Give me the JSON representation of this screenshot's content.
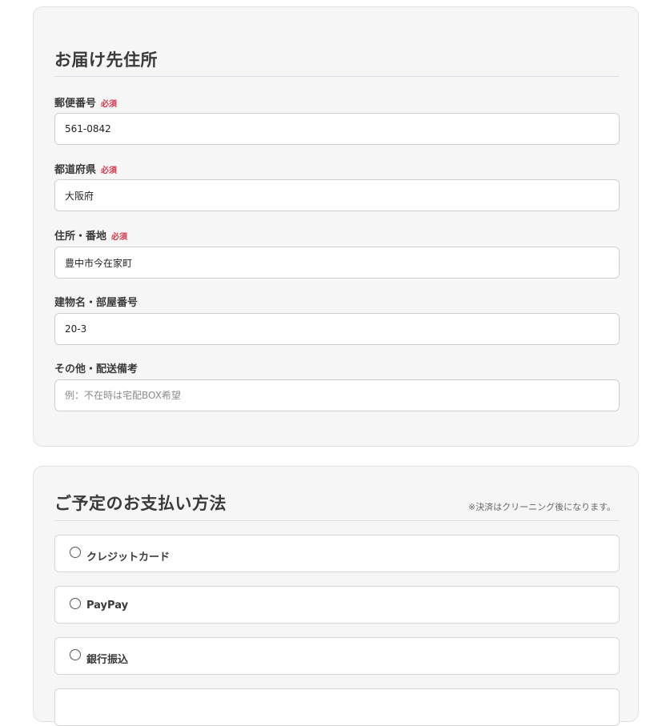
{
  "address_section": {
    "title": "お届け先住所",
    "fields": [
      {
        "label": "郵便番号",
        "required": true,
        "value": "561-0842",
        "placeholder": ""
      },
      {
        "label": "都道府県",
        "required": true,
        "value": "大阪府",
        "placeholder": ""
      },
      {
        "label": "住所・番地",
        "required": true,
        "value": "豊中市今在家町",
        "placeholder": ""
      },
      {
        "label": "建物名・部屋番号",
        "required": false,
        "value": "20-3",
        "placeholder": ""
      },
      {
        "label": "その他・配送備考",
        "required": false,
        "value": "",
        "placeholder": "例：不在時は宅配BOX希望"
      }
    ],
    "required_label": "必須"
  },
  "payment_section": {
    "title": "ご予定のお支払い方法",
    "note": "※決済はクリーニング後になります。",
    "options": [
      {
        "label": "クレジットカード",
        "selected": false
      },
      {
        "label": "PayPay",
        "selected": false
      },
      {
        "label": "銀行振込",
        "selected": false
      }
    ]
  },
  "colors": {
    "required": "#d8364a",
    "card_bg": "#f6f6f6",
    "divider": "#dcdce6"
  }
}
